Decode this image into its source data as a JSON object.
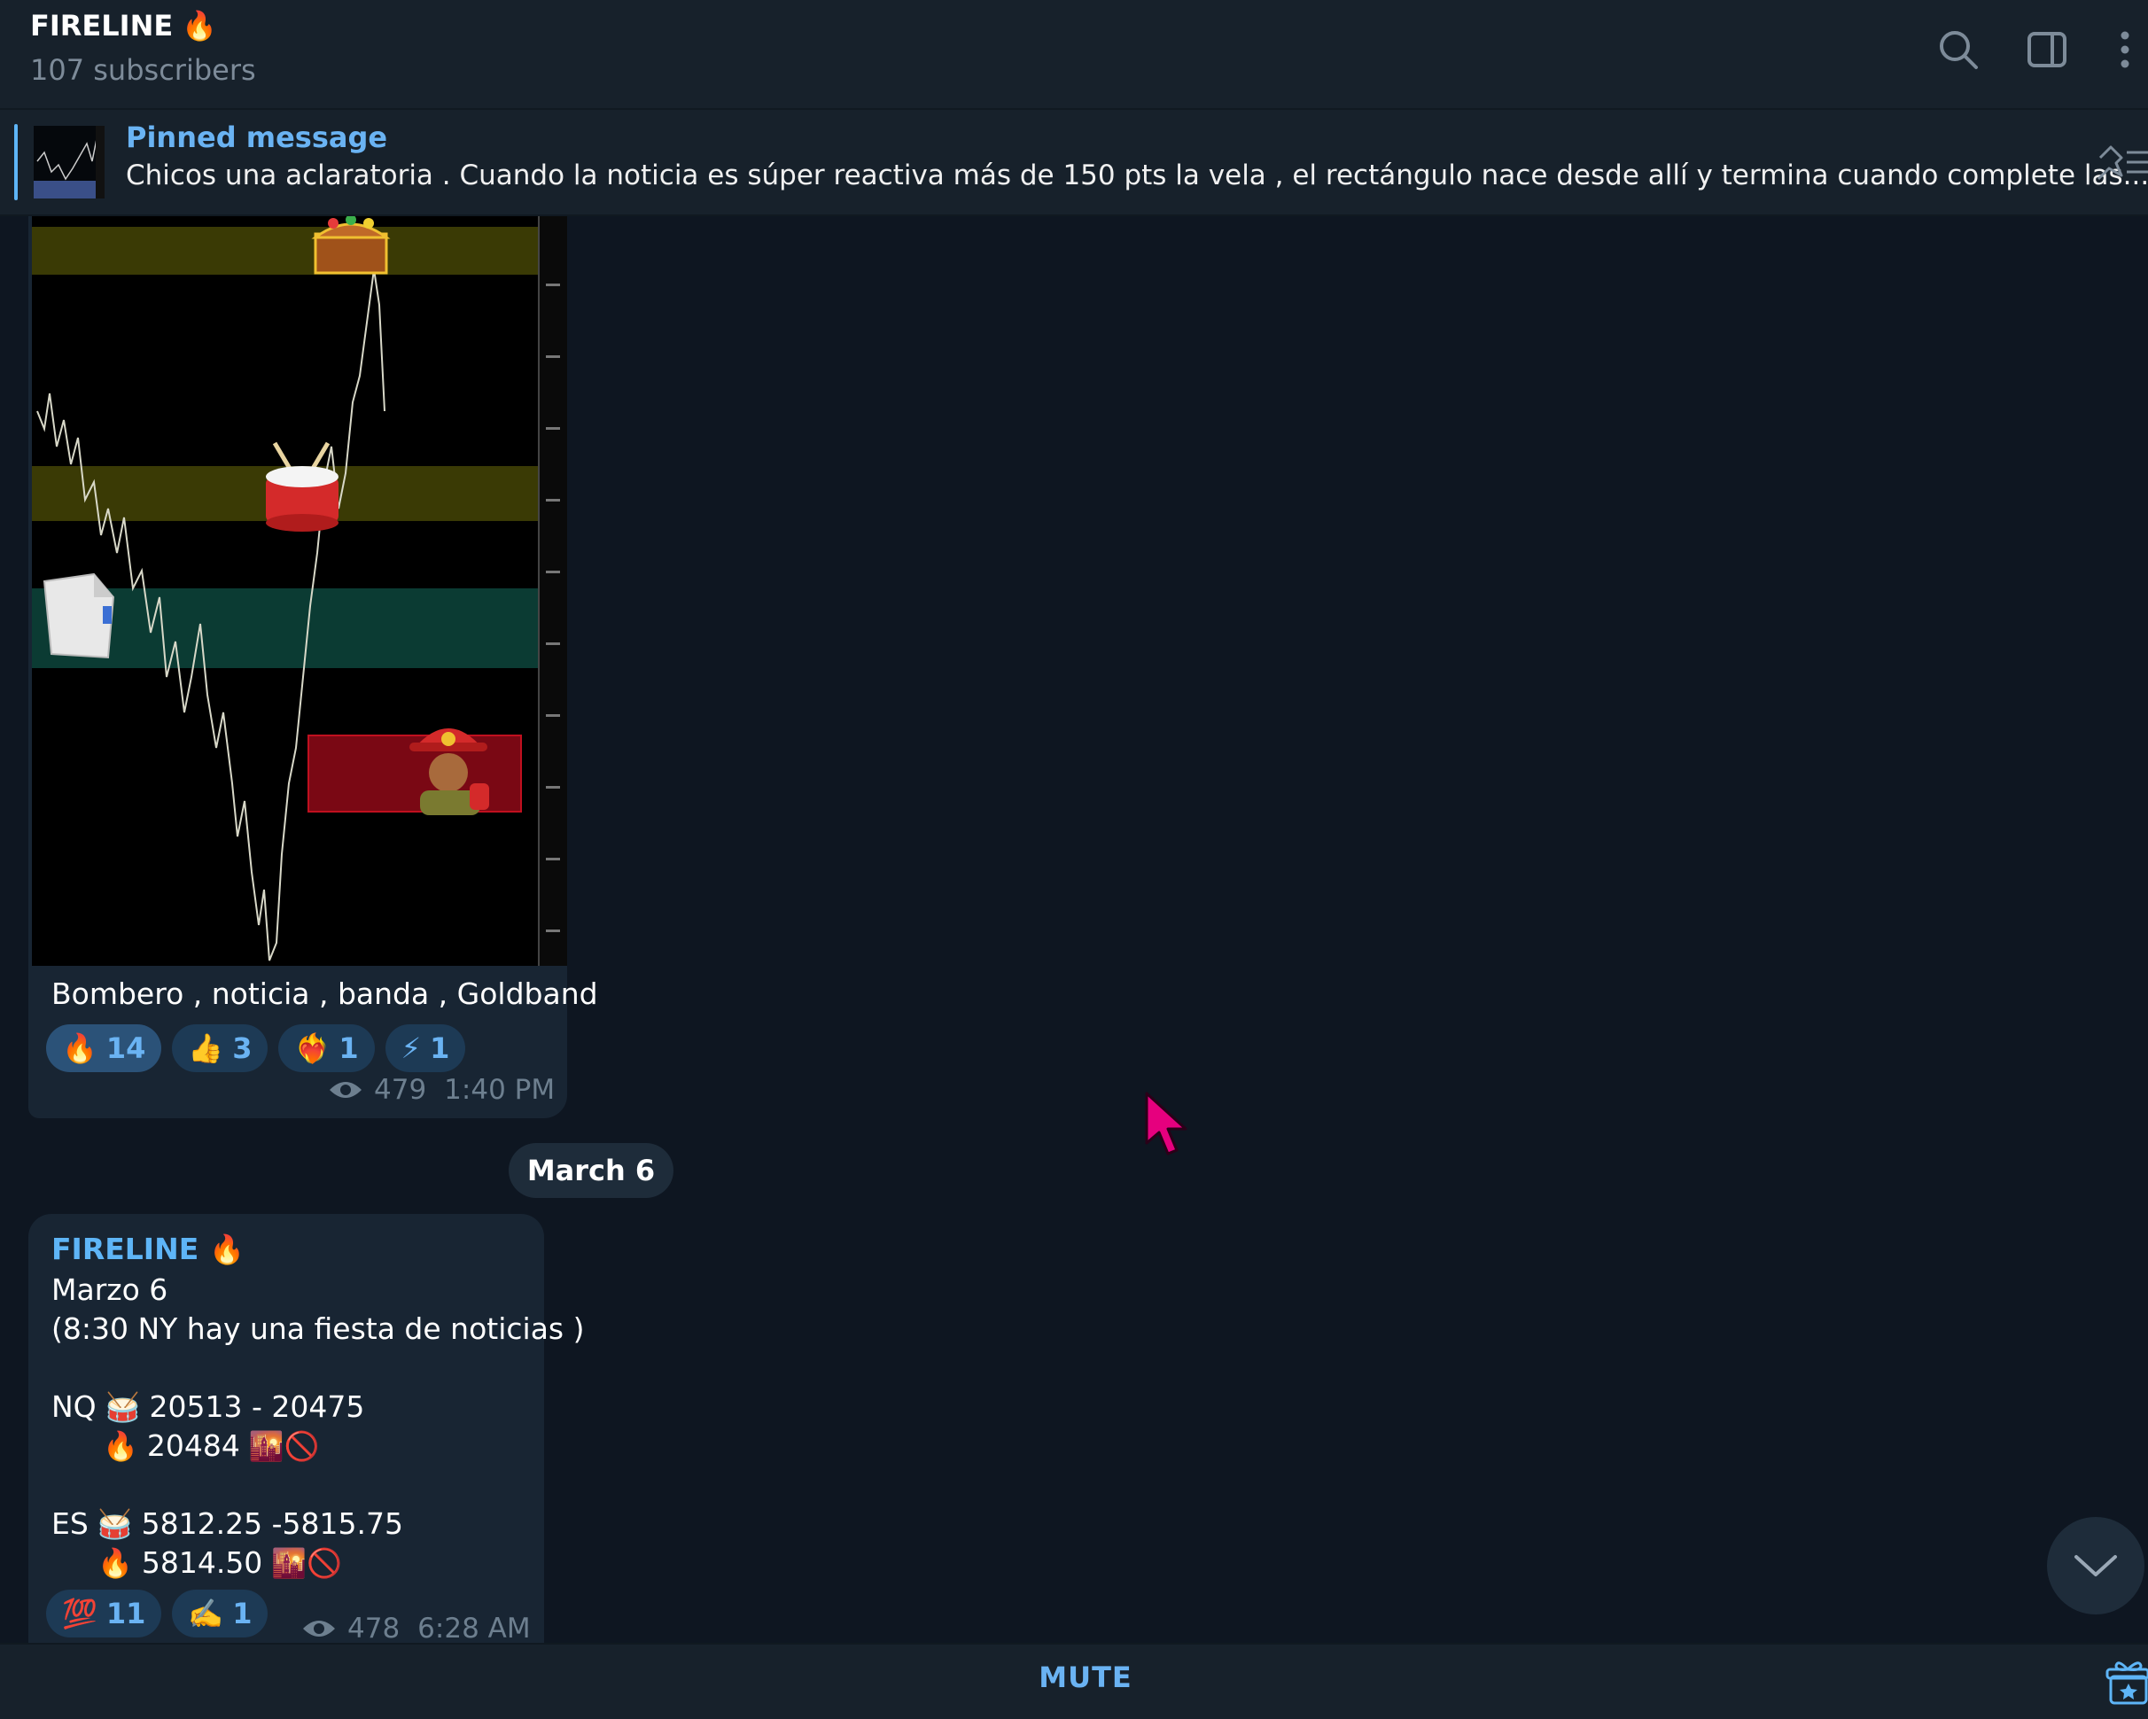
{
  "channel": {
    "title": "FIRELINE",
    "title_emoji": "🔥",
    "subscribers": "107 subscribers"
  },
  "header_icons": [
    "search-icon",
    "sidebar-toggle-icon",
    "more-vertical-icon"
  ],
  "pinned": {
    "label": "Pinned message",
    "text": "Chicos una aclaratoria .  Cuando la noticia es súper reactiva más de 150 pts la vela , el rectángulo nace desde allí y termina cuando complete las..."
  },
  "message1": {
    "caption": "Bombero , noticia , banda , Goldband",
    "reactions": [
      {
        "emoji": "🔥",
        "count": "14"
      },
      {
        "emoji": "👍",
        "count": "3"
      },
      {
        "emoji": "❤️‍🔥",
        "count": "1"
      },
      {
        "emoji": "⚡",
        "count": "1"
      }
    ],
    "views": "479",
    "time": "1:40 PM",
    "image_stickers": [
      "treasure-chest",
      "drum",
      "document",
      "firefighter"
    ]
  },
  "date_separator": "March 6",
  "message2": {
    "author": "FIRELINE",
    "author_emoji": "🔥",
    "line1": "Marzo 6",
    "line2": "(8:30 NY hay una fiesta de noticias )",
    "nq_label": "NQ",
    "nq_drum": "🥁",
    "nq_range": "20513 - 20475",
    "nq_fire": "🔥",
    "nq_level": "20484",
    "nq_symbols": "🌇🚫",
    "es_label": "ES",
    "es_drum": "🥁",
    "es_range": "5812.25 -5815.75",
    "es_fire": "🔥",
    "es_level": "5814.50",
    "es_symbols": "🌇🚫",
    "reactions": [
      {
        "emoji": "💯",
        "count": "11"
      },
      {
        "emoji": "✍️",
        "count": "1"
      }
    ],
    "views": "478",
    "time": "6:28 AM"
  },
  "bottom_bar": {
    "mute_label": "MUTE"
  },
  "colors": {
    "background": "#0e1621",
    "header": "#17212b",
    "bubble": "#182533",
    "accent": "#6ab3f3",
    "cursor": "#e6007e"
  }
}
